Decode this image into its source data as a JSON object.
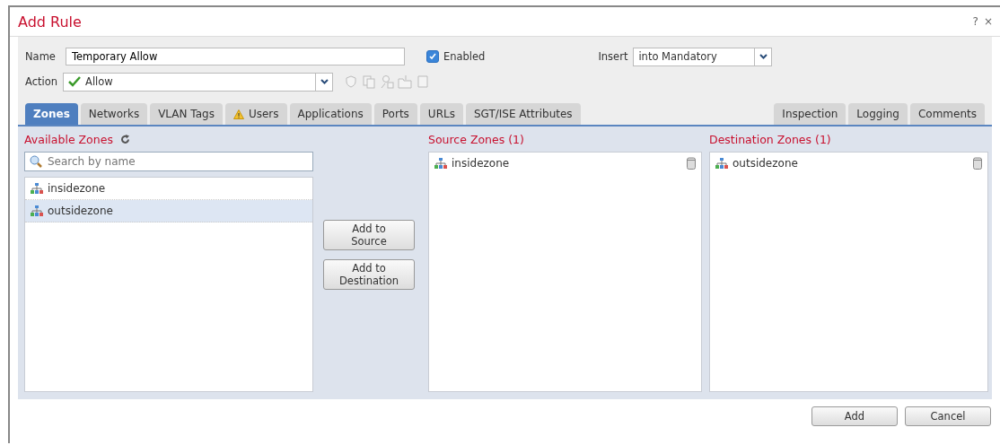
{
  "window": {
    "title": "Add Rule",
    "help": "?",
    "close": "×"
  },
  "form": {
    "name_label": "Name",
    "name_value": "Temporary Allow",
    "enabled_label": "Enabled",
    "enabled": true,
    "insert_label": "Insert",
    "insert_value": "into Mandatory",
    "action_label": "Action",
    "action_value": "Allow"
  },
  "tabs_left": [
    {
      "label": "Zones",
      "selected": true,
      "warning": false
    },
    {
      "label": "Networks",
      "selected": false,
      "warning": false
    },
    {
      "label": "VLAN Tags",
      "selected": false,
      "warning": false
    },
    {
      "label": "Users",
      "selected": false,
      "warning": true
    },
    {
      "label": "Applications",
      "selected": false,
      "warning": false
    },
    {
      "label": "Ports",
      "selected": false,
      "warning": false
    },
    {
      "label": "URLs",
      "selected": false,
      "warning": false
    },
    {
      "label": "SGT/ISE Attributes",
      "selected": false,
      "warning": false
    }
  ],
  "tabs_right": [
    {
      "label": "Inspection",
      "selected": false,
      "warning": false
    },
    {
      "label": "Logging",
      "selected": false,
      "warning": false
    },
    {
      "label": "Comments",
      "selected": false,
      "warning": false
    }
  ],
  "available": {
    "title": "Available Zones",
    "search_placeholder": "Search by name",
    "items": [
      {
        "name": "insidezone",
        "selected": false
      },
      {
        "name": "outsidezone",
        "selected": true
      }
    ]
  },
  "move_buttons": [
    "Add to Source",
    "Add to Destination"
  ],
  "source": {
    "title": "Source Zones (1)",
    "items": [
      "insidezone"
    ]
  },
  "destination": {
    "title": "Destination Zones (1)",
    "items": [
      "outsidezone"
    ]
  },
  "buttons": [
    "Add",
    "Cancel"
  ]
}
